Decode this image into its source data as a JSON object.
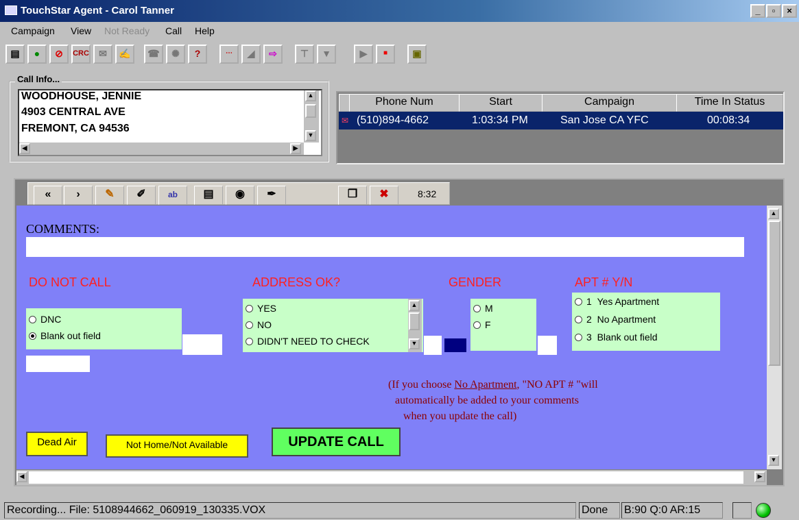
{
  "window": {
    "title": "TouchStar Agent - Carol Tanner"
  },
  "menu": [
    "Campaign",
    "View",
    "Not Ready",
    "Call",
    "Help"
  ],
  "toolbar": {
    "crc_label": "CRC"
  },
  "call_info": {
    "label": "Call Info...",
    "lines": [
      "WOODHOUSE, JENNIE",
      "4903  CENTRAL AVE",
      "FREMONT,  CA 94536"
    ]
  },
  "grid": {
    "headers": [
      "Phone Num",
      "Start",
      "Campaign",
      "Time In Status"
    ],
    "row": {
      "phone": "(510)894-4662",
      "start": "1:03:34 PM",
      "campaign": "San Jose CA YFC",
      "time": "00:08:34"
    }
  },
  "script_toolbar": {
    "back": "«",
    "next": "›",
    "timer": "8:32"
  },
  "form": {
    "comments_label": "COMMENTS:",
    "comments_value": "",
    "dnc": {
      "label": "DO NOT CALL",
      "options": [
        "DNC",
        "Blank out field"
      ],
      "selected": 1
    },
    "address": {
      "label": "ADDRESS OK?",
      "options": [
        "YES",
        "NO",
        "DIDN'T NEED TO CHECK"
      ]
    },
    "gender": {
      "label": "GENDER",
      "options": [
        "M",
        "F"
      ]
    },
    "apt": {
      "label": "APT # Y/N",
      "options": [
        {
          "num": "1",
          "text": "Yes Apartment"
        },
        {
          "num": "2",
          "text": "No Apartment"
        },
        {
          "num": "3",
          "text": "Blank out field"
        }
      ]
    },
    "note": {
      "pre": "(If you choose ",
      "link": "No Apartment",
      "post": ", \"NO APT # \"will",
      "line2": "automatically be added to your comments",
      "line3": "when you update the call)"
    },
    "buttons": {
      "dead_air": "Dead Air",
      "not_home": "Not Home/Not Available",
      "update": "UPDATE CALL"
    }
  },
  "status": {
    "recording": "Recording... File: 5108944662_060919_130335.VOX",
    "done": "Done",
    "stats": "B:90 Q:0 AR:15"
  },
  "colors": {
    "form_bg": "#8080f8",
    "option_bg": "#c8ffc8",
    "label_red": "#ff2020",
    "update_green": "#60ff60",
    "button_yellow": "#ffff00"
  }
}
